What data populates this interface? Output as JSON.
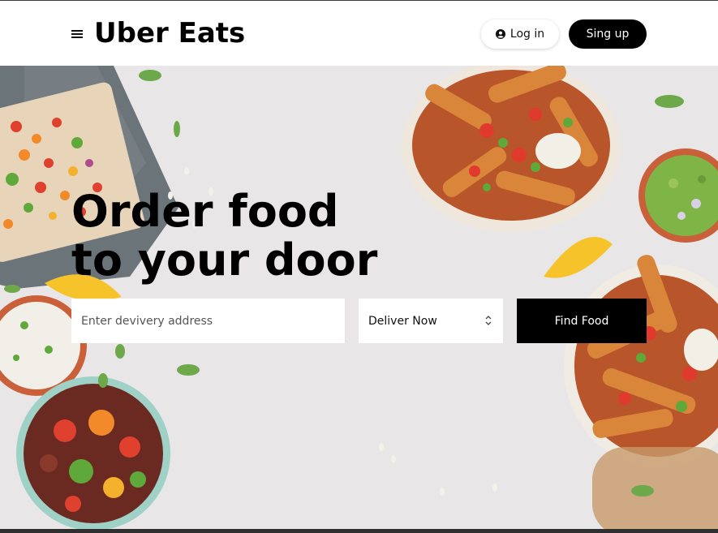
{
  "header": {
    "brand": "Uber Eats",
    "login_label": "Log in",
    "signup_label": "Sing up",
    "menu_icon": "hamburger-menu-icon",
    "login_icon": "user-circle-icon"
  },
  "hero": {
    "headline_line1": "Order food",
    "headline_line2": "to your door",
    "address_placeholder": "Enter devivery address",
    "address_value": "",
    "deliver_option": "Deliver Now",
    "find_label": "Find Food"
  },
  "colors": {
    "primary": "#000000",
    "background": "#ffffff",
    "hero_bg": "#e9e6e8"
  }
}
